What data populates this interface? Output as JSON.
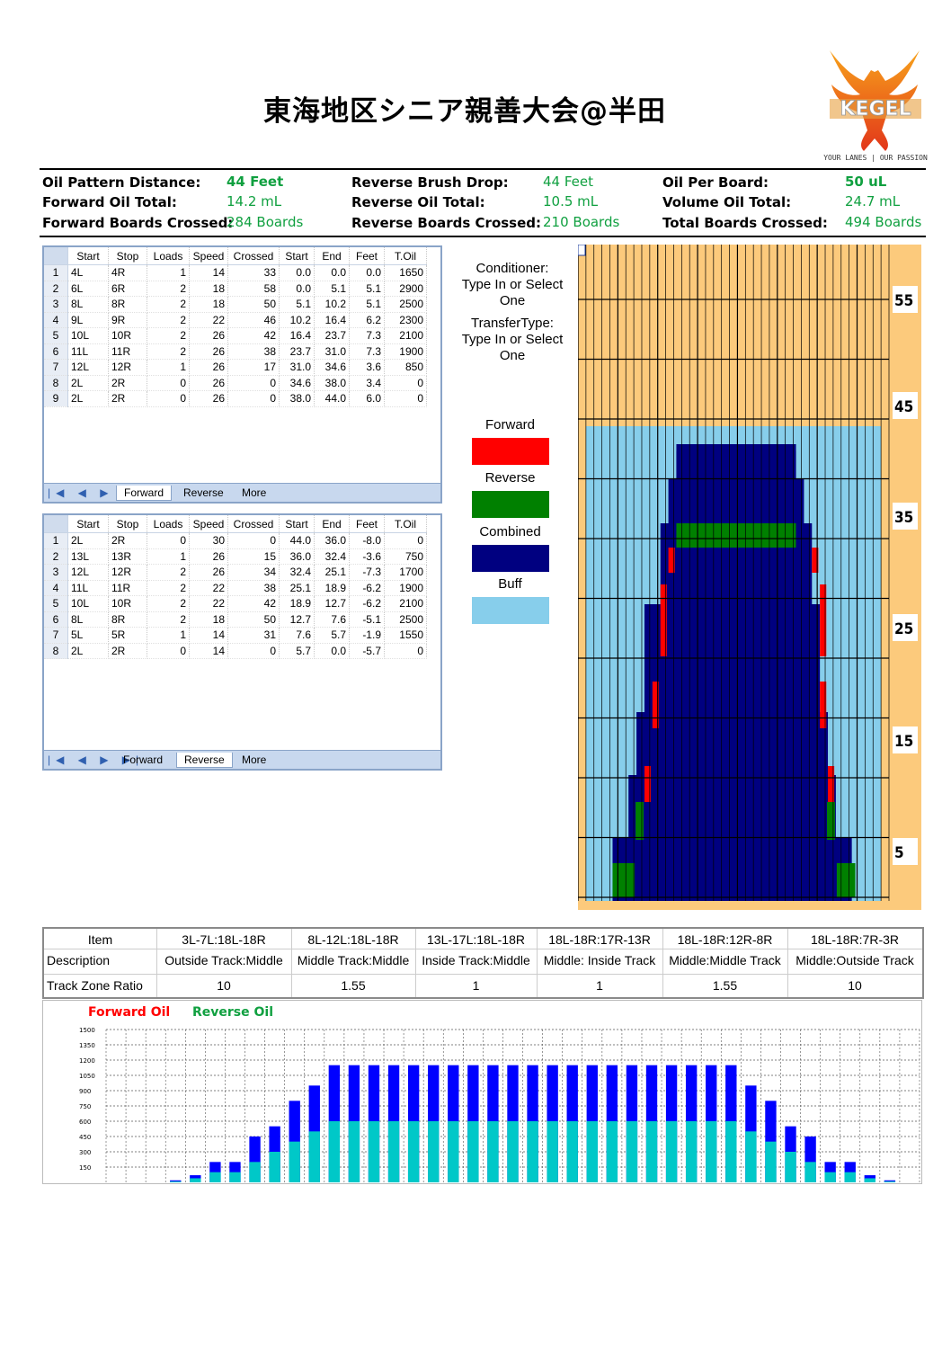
{
  "title": "東海地区シニア親善大会@半田",
  "logo": {
    "name": "KEGEL",
    "tagline": "YOUR LANES | OUR PASSION"
  },
  "summary": [
    {
      "label": "Oil Pattern Distance:",
      "value": "44 Feet",
      "bold": true
    },
    {
      "label": "Forward Oil Total:",
      "value": "14.2 mL",
      "bold": false
    },
    {
      "label": "Forward Boards Crossed:",
      "value": "284 Boards",
      "bold": false
    },
    {
      "label": "Reverse Brush Drop:",
      "value": "44 Feet",
      "bold": false
    },
    {
      "label": "Reverse Oil Total:",
      "value": "10.5 mL",
      "bold": false
    },
    {
      "label": "Reverse Boards Crossed:",
      "value": "210 Boards",
      "bold": false
    },
    {
      "label": "Oil Per Board:",
      "value": "50 uL",
      "bold": true
    },
    {
      "label": "Volume Oil Total:",
      "value": "24.7 mL",
      "bold": false
    },
    {
      "label": "Total Boards Crossed:",
      "value": "494 Boards",
      "bold": false
    }
  ],
  "grid_headers": [
    "Start",
    "Stop",
    "Loads",
    "Speed",
    "Crossed",
    "Start",
    "End",
    "Feet",
    "T.Oil"
  ],
  "grid_tabs": [
    "Forward",
    "Reverse",
    "More"
  ],
  "forward_rows": [
    [
      "1",
      "4L",
      "4R",
      "1",
      "14",
      "33",
      "0.0",
      "0.0",
      "0.0",
      "1650"
    ],
    [
      "2",
      "6L",
      "6R",
      "2",
      "18",
      "58",
      "0.0",
      "5.1",
      "5.1",
      "2900"
    ],
    [
      "3",
      "8L",
      "8R",
      "2",
      "18",
      "50",
      "5.1",
      "10.2",
      "5.1",
      "2500"
    ],
    [
      "4",
      "9L",
      "9R",
      "2",
      "22",
      "46",
      "10.2",
      "16.4",
      "6.2",
      "2300"
    ],
    [
      "5",
      "10L",
      "10R",
      "2",
      "26",
      "42",
      "16.4",
      "23.7",
      "7.3",
      "2100"
    ],
    [
      "6",
      "11L",
      "11R",
      "2",
      "26",
      "38",
      "23.7",
      "31.0",
      "7.3",
      "1900"
    ],
    [
      "7",
      "12L",
      "12R",
      "1",
      "26",
      "17",
      "31.0",
      "34.6",
      "3.6",
      "850"
    ],
    [
      "8",
      "2L",
      "2R",
      "0",
      "26",
      "0",
      "34.6",
      "38.0",
      "3.4",
      "0"
    ],
    [
      "9",
      "2L",
      "2R",
      "0",
      "26",
      "0",
      "38.0",
      "44.0",
      "6.0",
      "0"
    ]
  ],
  "reverse_rows": [
    [
      "1",
      "2L",
      "2R",
      "0",
      "30",
      "0",
      "44.0",
      "36.0",
      "-8.0",
      "0"
    ],
    [
      "2",
      "13L",
      "13R",
      "1",
      "26",
      "15",
      "36.0",
      "32.4",
      "-3.6",
      "750"
    ],
    [
      "3",
      "12L",
      "12R",
      "2",
      "26",
      "34",
      "32.4",
      "25.1",
      "-7.3",
      "1700"
    ],
    [
      "4",
      "11L",
      "11R",
      "2",
      "22",
      "38",
      "25.1",
      "18.9",
      "-6.2",
      "1900"
    ],
    [
      "5",
      "10L",
      "10R",
      "2",
      "22",
      "42",
      "18.9",
      "12.7",
      "-6.2",
      "2100"
    ],
    [
      "6",
      "8L",
      "8R",
      "2",
      "18",
      "50",
      "12.7",
      "7.6",
      "-5.1",
      "2500"
    ],
    [
      "7",
      "5L",
      "5R",
      "1",
      "14",
      "31",
      "7.6",
      "5.7",
      "-1.9",
      "1550"
    ],
    [
      "8",
      "2L",
      "2R",
      "0",
      "14",
      "0",
      "5.7",
      "0.0",
      "-5.7",
      "0"
    ]
  ],
  "conditioner": {
    "line1": "Conditioner:",
    "line2": "Type In or Select",
    "line3": "One"
  },
  "transfer": {
    "line1": "TransferType:",
    "line2": "Type In or Select",
    "line3": "One"
  },
  "legend": [
    {
      "label": "Forward",
      "color": "#ff0000"
    },
    {
      "label": "Reverse",
      "color": "#008000"
    },
    {
      "label": "Combined",
      "color": "#000080"
    },
    {
      "label": "Buff",
      "color": "#87ceeb"
    }
  ],
  "lane_chart": {
    "feet_labels": [
      "55",
      "45",
      "35",
      "25",
      "15",
      "5"
    ],
    "colors": {
      "bg": "#fcca7c",
      "buff": "#87ceeb",
      "combined": "#000080",
      "forward": "#ff0000",
      "reverse": "#008000"
    }
  },
  "zone_table": {
    "headers": [
      "Item",
      "3L-7L:18L-18R",
      "8L-12L:18L-18R",
      "13L-17L:18L-18R",
      "18L-18R:17R-13R",
      "18L-18R:12R-8R",
      "18L-18R:7R-3R"
    ],
    "descriptions": [
      "Description",
      "Outside Track:Middle",
      "Middle Track:Middle",
      "Inside Track:Middle",
      "Middle: Inside Track",
      "Middle:Middle Track",
      "Middle:Outside Track"
    ],
    "ratios": [
      "Track Zone Ratio",
      "10",
      "1.55",
      "1",
      "1",
      "1.55",
      "10"
    ]
  },
  "chart_data": {
    "type": "bar",
    "stacked": true,
    "series": [
      {
        "name": "Forward Oil",
        "color": "#00c8c8",
        "values": [
          0,
          50,
          100,
          100,
          100,
          150,
          300,
          400,
          500,
          600,
          600,
          600,
          600,
          600,
          600,
          600,
          600,
          600,
          600,
          600,
          600,
          600,
          600,
          600,
          600,
          600,
          600,
          600,
          600,
          600,
          600,
          600,
          500,
          400,
          300,
          150,
          100,
          100,
          100,
          50,
          0
        ]
      },
      {
        "name": "Reverse Oil",
        "color": "#0000ff",
        "values": [
          0,
          0,
          0,
          0,
          0,
          0,
          0,
          0,
          0,
          0,
          0,
          0,
          0,
          0,
          0,
          0,
          0,
          0,
          0,
          0,
          0,
          0,
          0,
          0,
          0,
          0,
          0,
          0,
          0,
          0,
          0,
          0,
          0,
          0,
          0,
          0,
          0,
          0,
          0,
          0,
          0
        ]
      }
    ],
    "fwd_vals": [
      0,
      0,
      0,
      20,
      50,
      150,
      150,
      300,
      400,
      550,
      600,
      600,
      600,
      600,
      600,
      600,
      600,
      600,
      600,
      600,
      600,
      600,
      600,
      600,
      600,
      600,
      600,
      600,
      600,
      600,
      600,
      550,
      400,
      300,
      150,
      150,
      50,
      20,
      0,
      0,
      0
    ],
    "rev_vals": [
      0,
      0,
      0,
      0,
      0,
      0,
      0,
      0,
      0,
      0,
      0,
      0,
      0,
      0,
      0,
      0,
      0,
      0,
      0,
      0,
      0,
      0,
      0,
      0,
      0,
      0,
      0,
      0,
      0,
      0,
      0,
      0,
      0,
      0,
      0,
      0,
      0,
      0,
      0,
      0,
      0
    ],
    "totals": [
      0,
      0,
      0,
      20,
      70,
      200,
      200,
      400,
      550,
      800,
      950,
      1150,
      1150,
      1150,
      1150,
      1150,
      1150,
      1150,
      1150,
      1150,
      1150,
      1150,
      1150,
      1150,
      1150,
      1150,
      1150,
      1150,
      1150,
      1150,
      1150,
      1150,
      950,
      800,
      550,
      400,
      200,
      200,
      70,
      20,
      0
    ],
    "y_ticks": [
      "1500",
      "1350",
      "1200",
      "1050",
      "900",
      "750",
      "600",
      "450",
      "300",
      "150"
    ],
    "ylim": [
      0,
      1500
    ],
    "legend_labels": [
      "Forward Oil",
      "Reverse Oil"
    ],
    "legend_colors": [
      "#ff0000",
      "#10a040"
    ],
    "grid": true
  }
}
